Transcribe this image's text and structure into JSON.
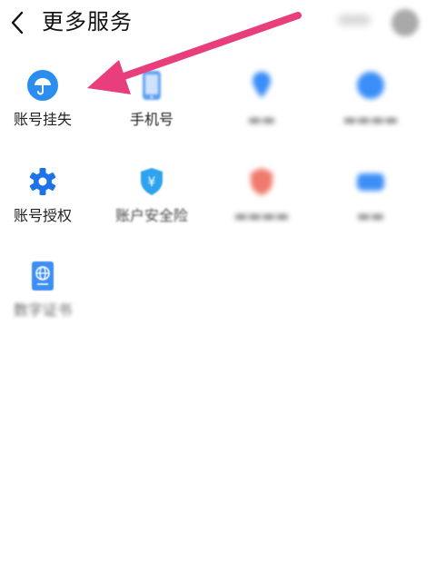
{
  "header": {
    "title": "更多服务"
  },
  "services": [
    {
      "label": "账号挂失",
      "icon": "umbrella-icon",
      "color": "#2b8df0"
    },
    {
      "label": "手机号",
      "icon": "phone-icon",
      "color": "#3d8ff5"
    },
    {
      "label": "",
      "icon": "pin-icon",
      "color": "#3a8ef7"
    },
    {
      "label": "",
      "icon": "circle-icon",
      "color": "#3a8ef7"
    },
    {
      "label": "账号授权",
      "icon": "gear-icon",
      "color": "#1d73e8"
    },
    {
      "label": "账户安全险",
      "icon": "shield-yuan-icon",
      "color": "#2fa3ee"
    },
    {
      "label": "",
      "icon": "red-badge-icon",
      "color": "#f07a6e"
    },
    {
      "label": "",
      "icon": "card-icon",
      "color": "#3d8ff5"
    },
    {
      "label": "数字证书",
      "icon": "passport-icon",
      "color": "#3d8ff5"
    }
  ],
  "annotation": {
    "arrow_color": "#e83e7b"
  }
}
